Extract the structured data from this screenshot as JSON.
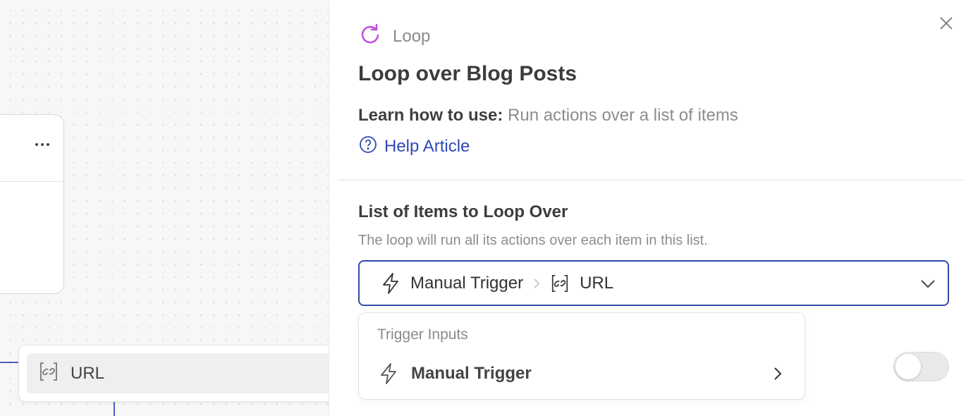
{
  "panel": {
    "kind_label": "Loop",
    "title": "Loop over Blog Posts",
    "learn_prefix": "Learn how to use:",
    "learn_text": "Run actions over a list of items",
    "help_label": "Help Article",
    "section_title": "List of Items to Loop Over",
    "section_desc": "The loop will run all its actions over each item in this list.",
    "select": {
      "trigger_label": "Manual Trigger",
      "field_label": "URL"
    },
    "dropdown": {
      "group_label": "Trigger Inputs",
      "option_label": "Manual Trigger"
    },
    "toggle_on": false
  },
  "canvas": {
    "url_option_label": "URL"
  },
  "colors": {
    "accent": "#3549a8",
    "link": "#2f49b5",
    "loop_icon": "#c44fe0",
    "edge": "#4a5fc1"
  },
  "icons": {
    "loop": "loop-arrow-icon",
    "close": "close-icon",
    "help": "question-circle-icon",
    "trigger": "lightning-bolt-icon",
    "link": "bracket-link-icon",
    "chevron_down": "chevron-down-icon",
    "chevron_right": "chevron-right-icon",
    "more": "more-dots-icon"
  }
}
